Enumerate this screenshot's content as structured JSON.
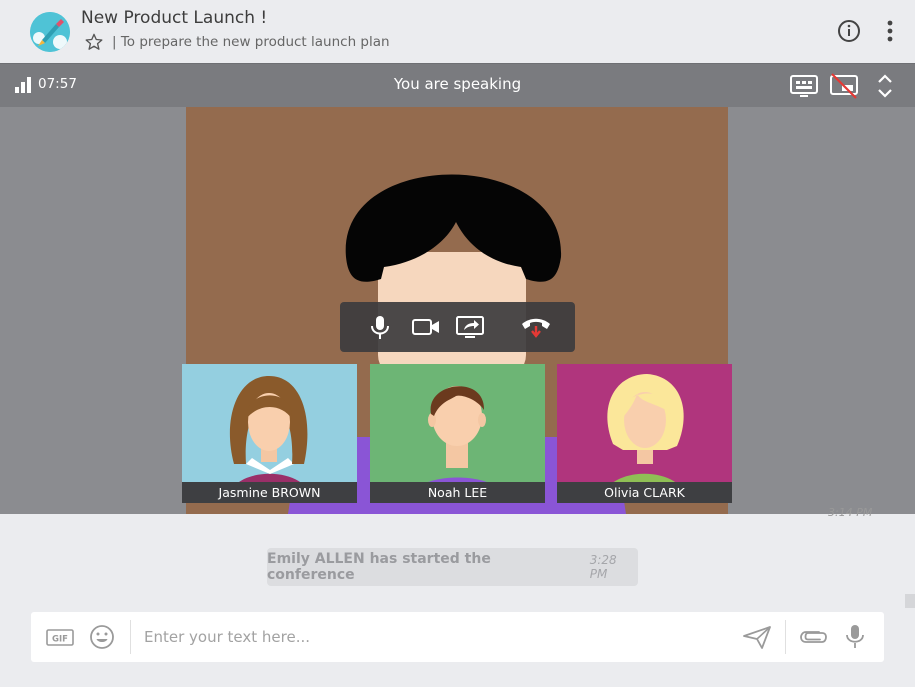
{
  "header": {
    "title": "New Product Launch !",
    "subtitle": "| To prepare the new product launch plan"
  },
  "call_bar": {
    "duration": "07:57",
    "status": "You are speaking"
  },
  "participants": [
    {
      "name": "Jasmine BROWN",
      "bg": "#94cfe0"
    },
    {
      "name": "Noah LEE",
      "bg": "#6db575"
    },
    {
      "name": "Olivia CLARK",
      "bg": "#b0357d"
    }
  ],
  "chat": {
    "peek_time": "3:14 PM",
    "system_message": {
      "text": "Emily ALLEN has started the conference",
      "time": "3:28 PM"
    },
    "composer": {
      "placeholder": "Enter your text here...",
      "gif_label": "GIF"
    }
  },
  "colors": {
    "accent": "#4fc3d6",
    "hangup": "#e53935",
    "main_video_bg": "#946b4e"
  }
}
